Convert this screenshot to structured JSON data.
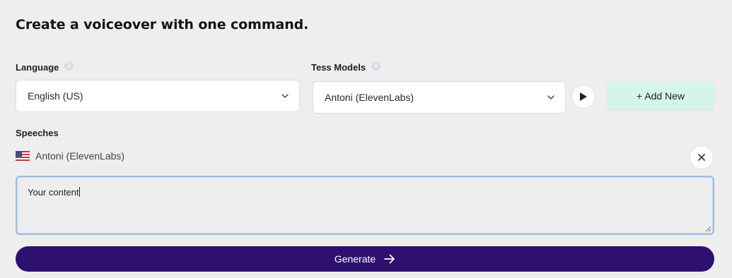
{
  "header": {
    "title": "Create a voiceover with one command."
  },
  "language": {
    "label": "Language",
    "info_icon": "info-icon",
    "selected": "English (US)"
  },
  "models": {
    "label": "Tess Models",
    "info_icon": "info-icon",
    "selected": "Antoni (ElevenLabs)",
    "play_icon": "play-icon"
  },
  "add_new": {
    "label": "+ Add New"
  },
  "speeches": {
    "label": "Speeches",
    "items": [
      {
        "flag_icon": "us-flag-icon",
        "voice": "Antoni (ElevenLabs)",
        "close_icon": "close-icon",
        "content": "Your content"
      }
    ]
  },
  "generate": {
    "label": "Generate",
    "icon": "arrow-right-icon"
  },
  "colors": {
    "background": "#eeeeee",
    "generate_bg": "#2d1070",
    "add_new_bg": "#d5f5e8",
    "focus_border": "#9dbcde"
  }
}
